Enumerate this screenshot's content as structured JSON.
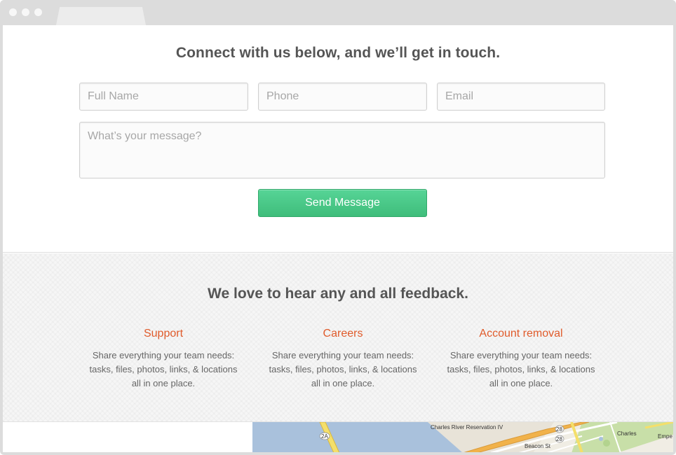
{
  "contact": {
    "heading": "Connect with us below, and we’ll get in touch.",
    "full_name_placeholder": "Full Name",
    "phone_placeholder": "Phone",
    "email_placeholder": "Email",
    "message_placeholder": "What’s your message?",
    "send_label": "Send Message"
  },
  "feedback": {
    "heading": "We love to hear any and all feedback.",
    "columns": [
      {
        "title": "Support",
        "text": "Share everything your team needs: tasks, files, photos, links, & locations all in one place."
      },
      {
        "title": "Careers",
        "text": "Share everything your team needs: tasks, files, photos, links, & locations all in one place."
      },
      {
        "title": "Account removal",
        "text": "Share everything your team needs: tasks, files, photos, links, & locations all in one place."
      }
    ]
  },
  "map": {
    "labels": {
      "reservation": "Charles River Reservation IV",
      "route_2a": "2A",
      "route_28": "28",
      "beacon": "Beacon St",
      "charles": "Charles",
      "emp": "Empe"
    }
  },
  "colors": {
    "accent_orange": "#e05b2b",
    "button_green": "#4bc888",
    "text_gray": "#555555"
  }
}
